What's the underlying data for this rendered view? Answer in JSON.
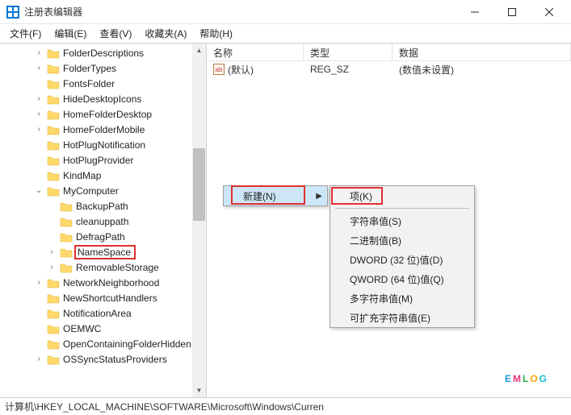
{
  "window": {
    "title": "注册表编辑器"
  },
  "menubar": {
    "file": "文件(F)",
    "edit": "编辑(E)",
    "view": "查看(V)",
    "favorites": "收藏夹(A)",
    "help": "帮助(H)"
  },
  "tree": {
    "items": [
      {
        "label": "FolderDescriptions",
        "depth": 2,
        "expand": ">"
      },
      {
        "label": "FolderTypes",
        "depth": 2,
        "expand": ">"
      },
      {
        "label": "FontsFolder",
        "depth": 2,
        "expand": ""
      },
      {
        "label": "HideDesktopIcons",
        "depth": 2,
        "expand": ">"
      },
      {
        "label": "HomeFolderDesktop",
        "depth": 2,
        "expand": ">"
      },
      {
        "label": "HomeFolderMobile",
        "depth": 2,
        "expand": ">"
      },
      {
        "label": "HotPlugNotification",
        "depth": 2,
        "expand": ""
      },
      {
        "label": "HotPlugProvider",
        "depth": 2,
        "expand": ""
      },
      {
        "label": "KindMap",
        "depth": 2,
        "expand": ""
      },
      {
        "label": "MyComputer",
        "depth": 2,
        "expand": "v"
      },
      {
        "label": "BackupPath",
        "depth": 3,
        "expand": ""
      },
      {
        "label": "cleanuppath",
        "depth": 3,
        "expand": ""
      },
      {
        "label": "DefragPath",
        "depth": 3,
        "expand": ""
      },
      {
        "label": "NameSpace",
        "depth": 3,
        "expand": ">",
        "highlighted": true
      },
      {
        "label": "RemovableStorage",
        "depth": 3,
        "expand": ">"
      },
      {
        "label": "NetworkNeighborhood",
        "depth": 2,
        "expand": ">"
      },
      {
        "label": "NewShortcutHandlers",
        "depth": 2,
        "expand": ""
      },
      {
        "label": "NotificationArea",
        "depth": 2,
        "expand": ""
      },
      {
        "label": "OEMWC",
        "depth": 2,
        "expand": ""
      },
      {
        "label": "OpenContainingFolderHidden",
        "depth": 2,
        "expand": ""
      },
      {
        "label": "OSSyncStatusProviders",
        "depth": 2,
        "expand": ">"
      }
    ]
  },
  "list": {
    "columns": {
      "name": "名称",
      "type": "类型",
      "data": "数据"
    },
    "rows": [
      {
        "name": "(默认)",
        "type": "REG_SZ",
        "data": "(数值未设置)"
      }
    ]
  },
  "context1": {
    "new": "新建(N)"
  },
  "context2": {
    "key": "项(K)",
    "string": "字符串值(S)",
    "binary": "二进制值(B)",
    "dword": "DWORD (32 位)值(D)",
    "qword": "QWORD (64 位)值(Q)",
    "multi": "多字符串值(M)",
    "expand": "可扩充字符串值(E)"
  },
  "statusbar": {
    "path": "计算机\\HKEY_LOCAL_MACHINE\\SOFTWARE\\Microsoft\\Windows\\Curren"
  },
  "logo": {
    "c1": "E",
    "c2": "M",
    "c3": "L",
    "c4": "O",
    "c5": "G"
  }
}
